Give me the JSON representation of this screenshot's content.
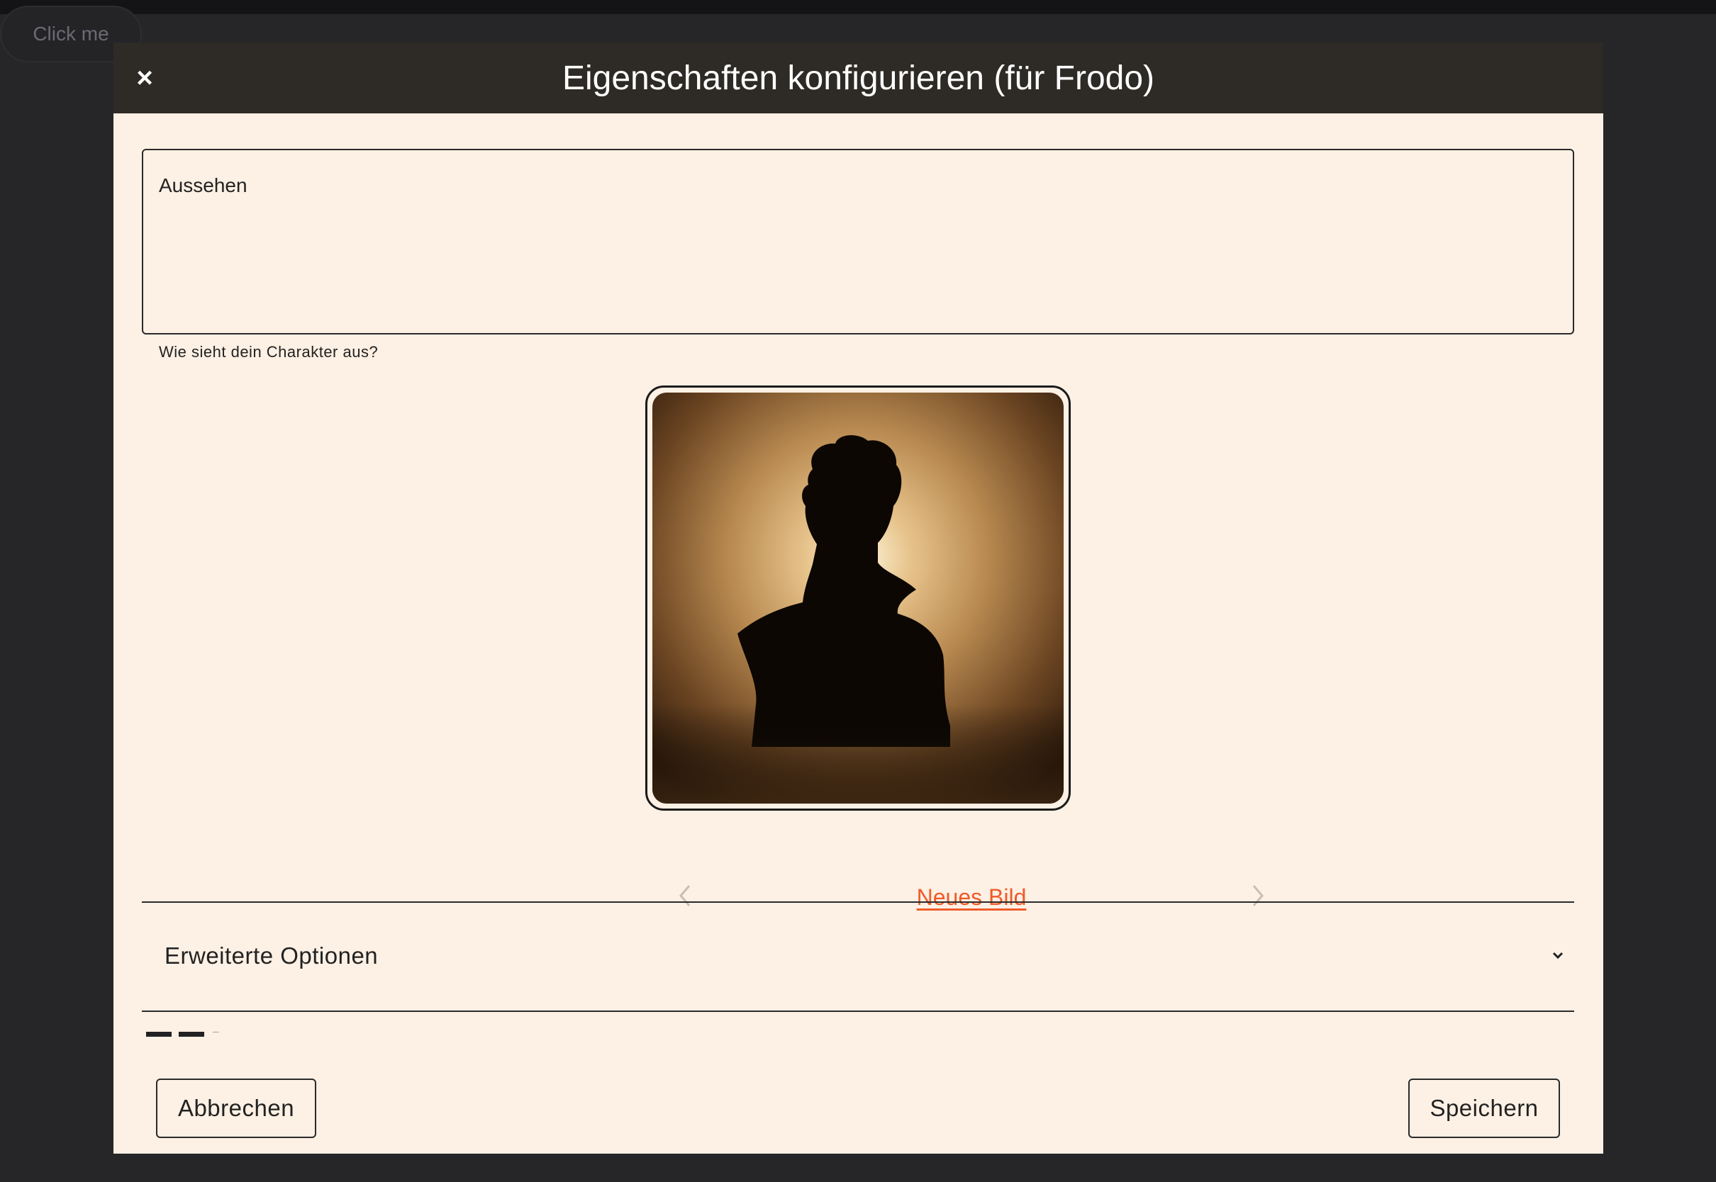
{
  "background_button": {
    "label": "Click me"
  },
  "dialog": {
    "title": "Eigenschaften konfigurieren (für Frodo)",
    "close_symbol": "×",
    "appearance": {
      "label": "Aussehen",
      "value": "",
      "helper": "Wie sieht dein Charakter aus?"
    },
    "image": {
      "new_image_label": "Neues Bild",
      "prev_icon": "chevron-left-icon",
      "next_icon": "chevron-right-icon"
    },
    "advanced": {
      "label": "Erweiterte Optionen",
      "icon": "chevron-down-icon"
    },
    "footer": {
      "cancel_label": "Abbrechen",
      "save_label": "Speichern"
    }
  },
  "colors": {
    "header_bg": "#2e2b26",
    "dialog_bg": "#fdf0e4",
    "link": "#f05b2a",
    "overlay": "#262628"
  }
}
